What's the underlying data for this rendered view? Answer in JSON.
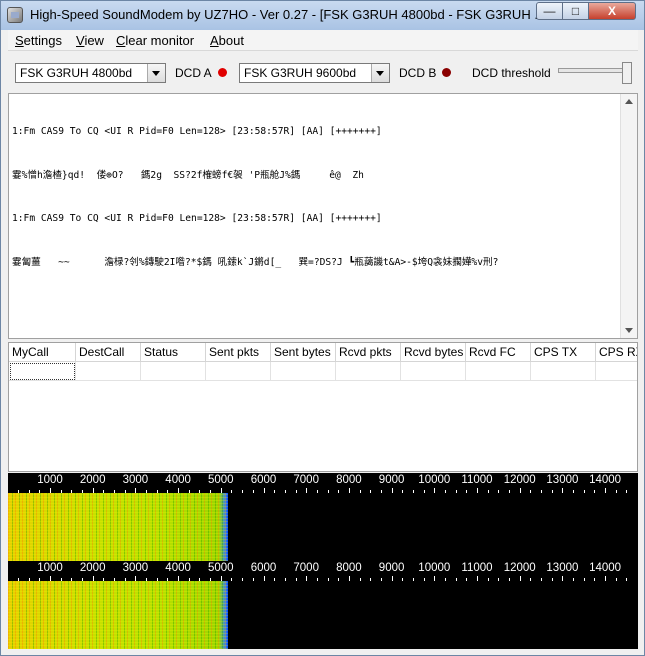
{
  "window": {
    "title": "High-Speed SoundModem by UZ7HO - Ver 0.27 - [FSK G3RUH 4800bd - FSK G3RUH ...",
    "min_glyph": "—",
    "max_glyph": "□",
    "close_glyph": "X"
  },
  "menu": {
    "items": [
      "Settings",
      "View",
      "Clear monitor",
      "About"
    ]
  },
  "toolbar": {
    "modem_a": "FSK G3RUH 4800bd",
    "dcd_a_label": "DCD A",
    "dcd_a_color": "#e00000",
    "modem_b": "FSK G3RUH 9600bd",
    "dcd_b_label": "DCD B",
    "dcd_b_color": "#8a0000",
    "dcd_threshold_label": "DCD threshold"
  },
  "monitor": {
    "lines": [
      "1:Fm CAS9 To CQ <UI R Pid=F0 Len=128> [23:58:57R] [AA] [+++++++]",
      "霎%憎h澹楂}qd!  偻⊕O?   鎷2g  SS?2f榷螃f€袈 'P瓶舱J%鎷     ê@  Zh",
      "1:Fm CAS9 To CQ <UI R Pid=F0 Len=128> [23:58:57R] [AA] [+++++++]",
      "霎匐薑   ~~      澹椂?刢%鏄駛2I喒?*$鎷 吼鎍k`J鏘d[_   巽=?DS?J ┗瓶藹譏t&A>-$垮Q衾妹擱嬅%v刑?"
    ]
  },
  "stats": {
    "columns": [
      "MyCall",
      "DestCall",
      "Status",
      "Sent pkts",
      "Sent bytes",
      "Rcvd pkts",
      "Rcvd bytes",
      "Rcvd FC",
      "CPS TX",
      "CPS RX"
    ]
  },
  "spectrum": {
    "scale_labels": [
      "1000",
      "2000",
      "3000",
      "4000",
      "5000",
      "6000",
      "7000",
      "8000",
      "9000",
      "10000",
      "11000",
      "12000",
      "13000",
      "14000"
    ]
  }
}
